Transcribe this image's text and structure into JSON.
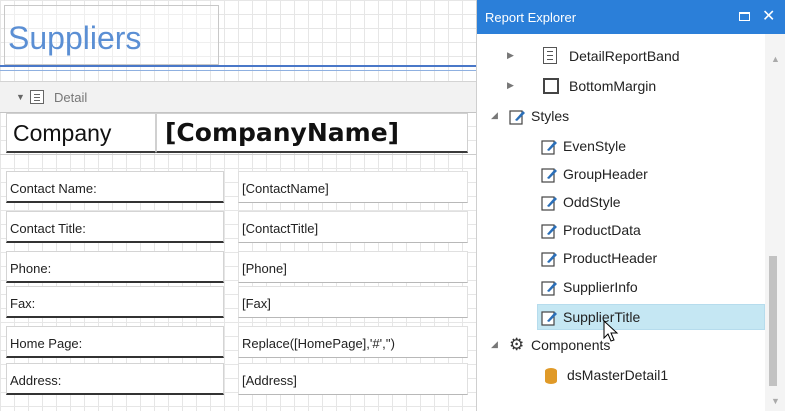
{
  "report": {
    "title": "Suppliers",
    "band_label": "Detail",
    "company_label": "Company",
    "company_field": "[CompanyName]",
    "fields": [
      {
        "label": "Contact Name:",
        "value": "[ContactName]"
      },
      {
        "label": "Contact Title:",
        "value": "[ContactTitle]"
      },
      {
        "label": "Phone:",
        "value": "[Phone]"
      },
      {
        "label": "Fax:",
        "value": "[Fax]"
      },
      {
        "label": "Home Page:",
        "value": "Replace([HomePage],'#','')"
      },
      {
        "label": "Address:",
        "value": "[Address]"
      }
    ]
  },
  "explorer": {
    "title": "Report Explorer",
    "items": {
      "detail_report_band": "DetailReportBand",
      "bottom_margin": "BottomMargin",
      "styles": "Styles",
      "style_items": [
        "EvenStyle",
        "GroupHeader",
        "OddStyle",
        "ProductData",
        "ProductHeader",
        "SupplierInfo",
        "SupplierTitle"
      ],
      "components": "Components",
      "data_source": "dsMasterDetail1"
    },
    "selected": "SupplierTitle"
  },
  "colors": {
    "accent": "#2b7fd9",
    "title_blue": "#5b8fd4",
    "selection": "#c5e7f3"
  },
  "icons": [
    "band-icon",
    "margin-icon",
    "styles-icon",
    "style-item-icon",
    "gear-icon",
    "database-icon",
    "maximize-icon",
    "close-icon"
  ]
}
